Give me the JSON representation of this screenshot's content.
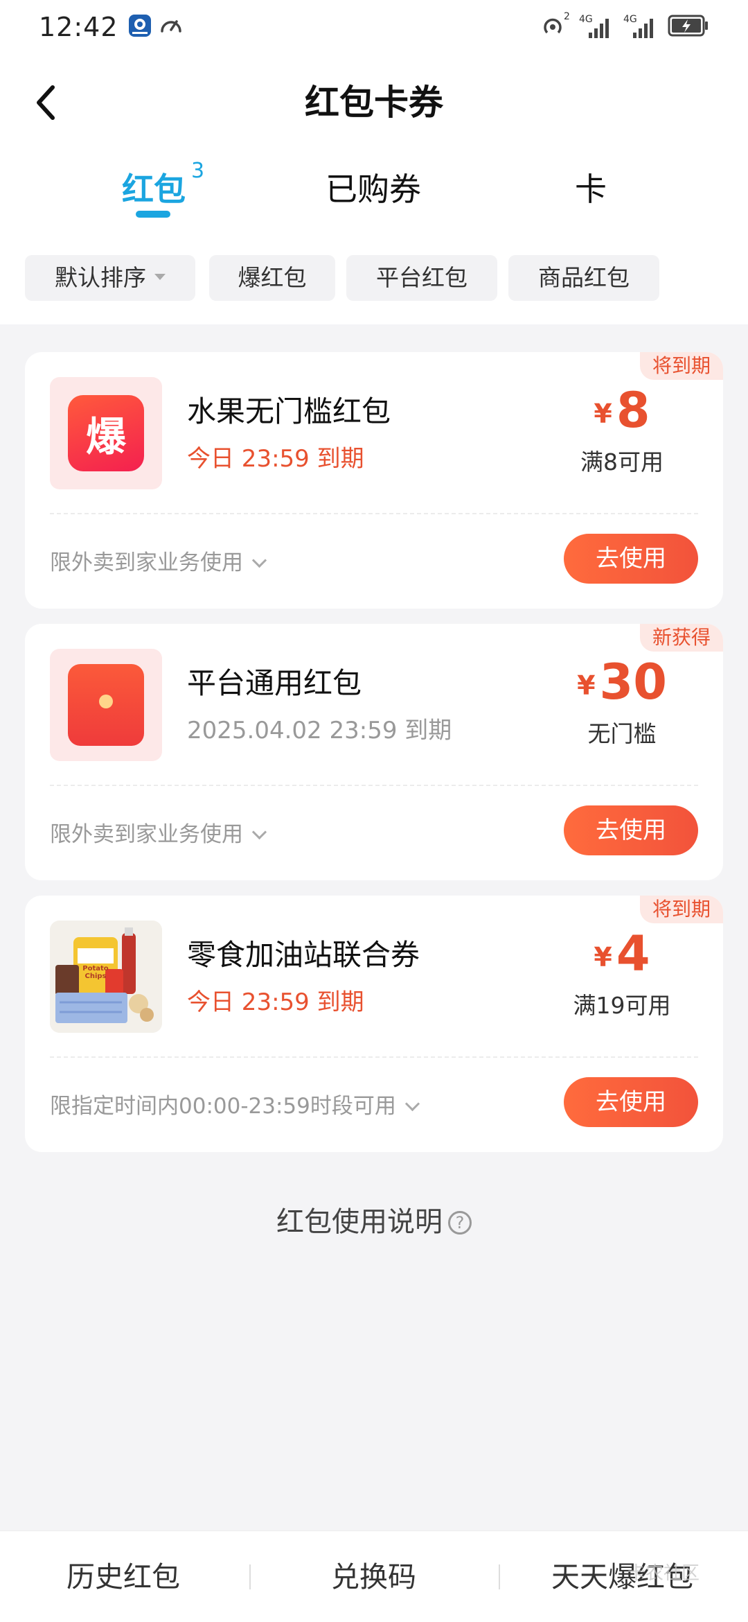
{
  "status_bar": {
    "time": "12:42",
    "signal1_label": "4G",
    "signal2_label": "4G",
    "wifi_label": "2"
  },
  "header": {
    "title": "红包卡券",
    "tabs": [
      {
        "label": "红包",
        "badge": "3",
        "active": true
      },
      {
        "label": "已购券"
      },
      {
        "label": "卡"
      }
    ]
  },
  "filters": [
    {
      "label": "默认排序",
      "has_dropdown": true
    },
    {
      "label": "爆红包"
    },
    {
      "label": "平台红包"
    },
    {
      "label": "商品红包"
    }
  ],
  "coupons": [
    {
      "tag": "将到期",
      "name": "水果无门槛红包",
      "expiry": "今日 23:59 到期",
      "expiry_style": "red",
      "currency": "¥",
      "amount": "8",
      "condition": "满8可用",
      "scope": "限外卖到家业务使用",
      "button": "去使用",
      "icon": "bao-icon",
      "icon_text": "爆"
    },
    {
      "tag": "新获得",
      "name": "平台通用红包",
      "expiry": "2025.04.02 23:59 到期",
      "expiry_style": "gray",
      "currency": "¥",
      "amount": "30",
      "condition": "无门槛",
      "scope": "限外卖到家业务使用",
      "button": "去使用",
      "icon": "red-envelope-icon"
    },
    {
      "tag": "将到期",
      "name": "零食加油站联合券",
      "expiry": "今日 23:59 到期",
      "expiry_style": "red",
      "currency": "¥",
      "amount": "4",
      "condition": "满19可用",
      "scope": "限指定时间内00:00-23:59时段可用",
      "button": "去使用",
      "icon": "snacks-image",
      "icon_text": "Potato Chips"
    }
  ],
  "help_link": {
    "label": "红包使用说明",
    "icon_glyph": "?"
  },
  "bottom_bar": {
    "items": [
      "历史红包",
      "兑换码",
      "天天爆红包"
    ],
    "watermark": "卡农社区"
  },
  "colors": {
    "accent_blue": "#1ba5e0",
    "accent_red": "#e8512f",
    "button_gradient_start": "#ff6b3d",
    "button_gradient_end": "#f2533b",
    "background": "#f4f4f6"
  }
}
